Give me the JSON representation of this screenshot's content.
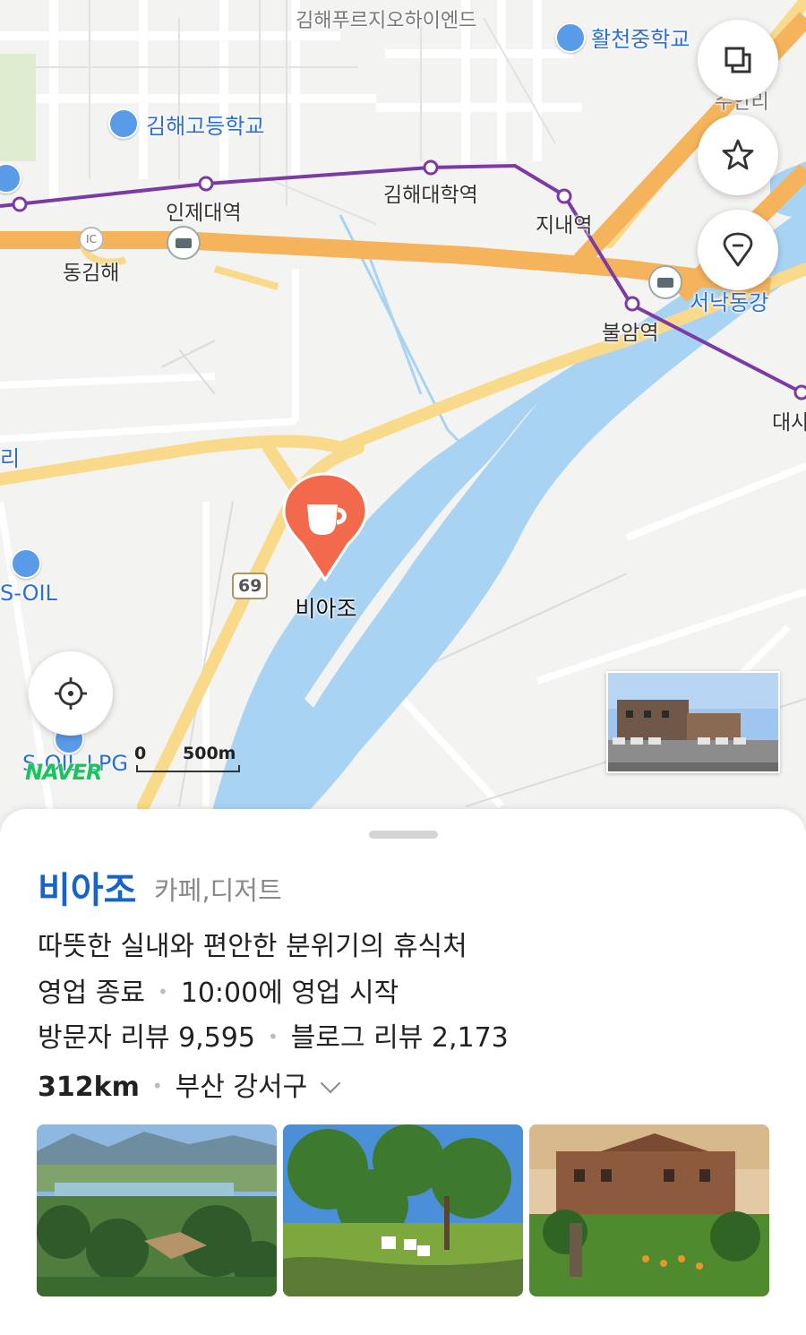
{
  "map": {
    "labels": {
      "outlet": "김해푸르지오하이엔드",
      "middle_school": "활천중학교",
      "high_school": "김해고등학교",
      "inje_station": "인제대역",
      "gimhae_univ_station": "김해대학역",
      "jinae_station": "지내역",
      "dong_gimhae": "동김해",
      "ic": "IC",
      "seonakdong": "서낙동강",
      "buram_station": "불암역",
      "daesa": "대사",
      "suanri": "수안리",
      "left_edge": "리",
      "s_oil": "S-OIL",
      "s_oil_lpg": "S-OIL LPG",
      "route_69": "69"
    },
    "marker_label": "비아조",
    "logo": "NAVER",
    "scale": {
      "zero": "0",
      "distance": "500m"
    },
    "buttons": {
      "layers_icon": "layers-icon",
      "favorite_icon": "star-icon",
      "location_pin_icon": "location-pin-icon",
      "current_location_icon": "crosshair-icon"
    },
    "colors": {
      "water": "#a9d3f3",
      "arterial": "#f9da8a",
      "highway": "#f5b45c",
      "subway": "#7c3aa5",
      "marker": "#f26a4b"
    }
  },
  "place": {
    "name": "비아조",
    "category": "카페,디저트",
    "description": "따뜻한 실내와 편안한 분위기의 휴식처",
    "status": "영업 종료",
    "hours": "10:00에 영업 시작",
    "visitor_reviews_label": "방문자 리뷰",
    "visitor_reviews": "9,595",
    "blog_reviews_label": "블로그 리뷰",
    "blog_reviews": "2,173",
    "distance": "312km",
    "address": "부산 강서구",
    "photos": [
      "garden-view-photo",
      "lawn-chairs-photo",
      "building-exterior-photo"
    ]
  }
}
